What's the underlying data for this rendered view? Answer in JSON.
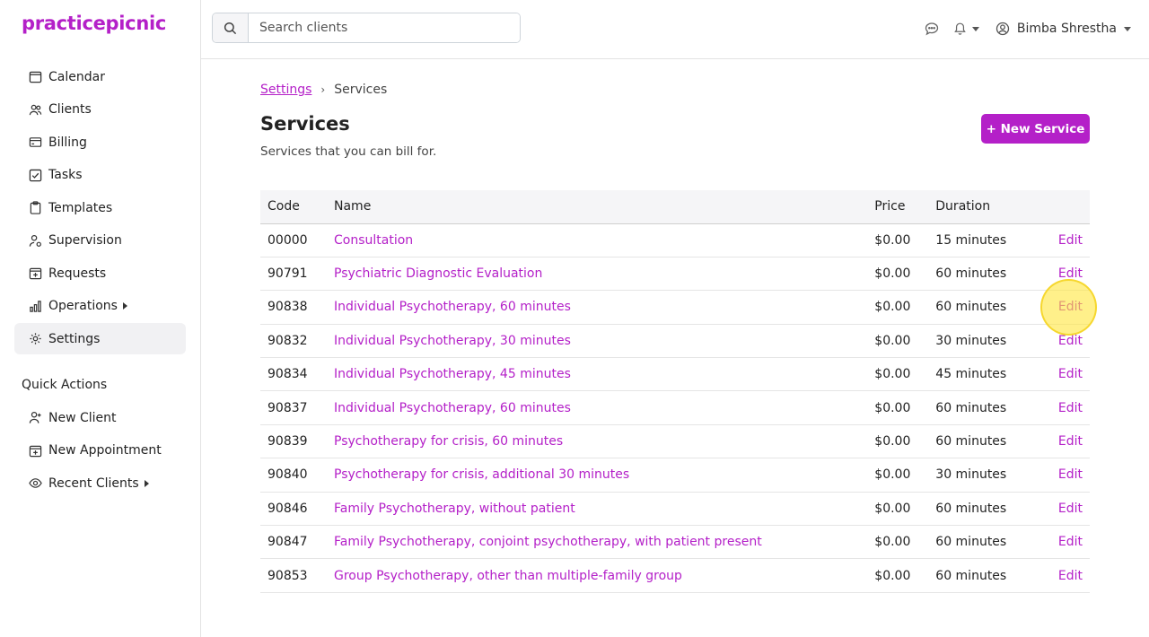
{
  "app": {
    "logo": "practicepicnic"
  },
  "search": {
    "placeholder": "Search clients"
  },
  "user": {
    "name": "Bimba Shrestha"
  },
  "sidebar": {
    "items": [
      {
        "label": "Calendar",
        "icon": "calendar-icon"
      },
      {
        "label": "Clients",
        "icon": "users-icon"
      },
      {
        "label": "Billing",
        "icon": "credit-card-icon"
      },
      {
        "label": "Tasks",
        "icon": "checkbox-icon"
      },
      {
        "label": "Templates",
        "icon": "clipboard-icon"
      },
      {
        "label": "Supervision",
        "icon": "user-gear-icon"
      },
      {
        "label": "Requests",
        "icon": "calendar-plus-icon"
      },
      {
        "label": "Operations",
        "icon": "bar-chart-icon"
      },
      {
        "label": "Settings",
        "icon": "gear-icon"
      }
    ],
    "quick_actions_title": "Quick Actions",
    "quick_actions": [
      {
        "label": "New Client",
        "icon": "user-plus-icon"
      },
      {
        "label": "New Appointment",
        "icon": "calendar-plus-icon"
      },
      {
        "label": "Recent Clients",
        "icon": "eye-icon"
      }
    ]
  },
  "breadcrumb": {
    "parent": "Settings",
    "current": "Services"
  },
  "page": {
    "title": "Services",
    "subtitle": "Services that you can bill for.",
    "new_button": "+ New Service"
  },
  "table": {
    "headers": {
      "code": "Code",
      "name": "Name",
      "price": "Price",
      "duration": "Duration"
    },
    "edit_label": "Edit",
    "rows": [
      {
        "code": "00000",
        "name": "Consultation",
        "price": "$0.00",
        "duration": "15 minutes"
      },
      {
        "code": "90791",
        "name": "Psychiatric Diagnostic Evaluation",
        "price": "$0.00",
        "duration": "60 minutes"
      },
      {
        "code": "90838",
        "name": "Individual Psychotherapy, 60 minutes",
        "price": "$0.00",
        "duration": "60 minutes"
      },
      {
        "code": "90832",
        "name": "Individual Psychotherapy, 30 minutes",
        "price": "$0.00",
        "duration": "30 minutes"
      },
      {
        "code": "90834",
        "name": "Individual Psychotherapy, 45 minutes",
        "price": "$0.00",
        "duration": "45 minutes"
      },
      {
        "code": "90837",
        "name": "Individual Psychotherapy, 60 minutes",
        "price": "$0.00",
        "duration": "60 minutes"
      },
      {
        "code": "90839",
        "name": "Psychotherapy for crisis, 60 minutes",
        "price": "$0.00",
        "duration": "60 minutes"
      },
      {
        "code": "90840",
        "name": "Psychotherapy for crisis, additional 30 minutes",
        "price": "$0.00",
        "duration": "30 minutes"
      },
      {
        "code": "90846",
        "name": "Family Psychotherapy, without patient",
        "price": "$0.00",
        "duration": "60 minutes"
      },
      {
        "code": "90847",
        "name": "Family Psychotherapy, conjoint psychotherapy, with patient present",
        "price": "$0.00",
        "duration": "60 minutes"
      },
      {
        "code": "90853",
        "name": "Group Psychotherapy, other than multiple-family group",
        "price": "$0.00",
        "duration": "60 minutes"
      }
    ]
  },
  "colors": {
    "brand": "#b420c8",
    "highlight": "#ffe63c"
  }
}
